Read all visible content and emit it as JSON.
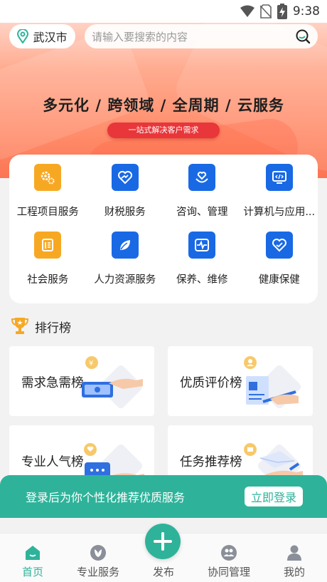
{
  "status_bar": {
    "time": "9:38",
    "icons": [
      "wifi-icon",
      "no-sim-icon",
      "battery-charging-icon"
    ]
  },
  "header": {
    "city": "武汉市",
    "search_placeholder": "请输入要搜索的内容"
  },
  "banner": {
    "title": "多元化 / 跨领域 / 全周期 / 云服务",
    "pill": "一站式解决客户需求"
  },
  "services": [
    {
      "label": "工程项目服务",
      "icon": "gear-cluster-icon",
      "color": "#f7a823"
    },
    {
      "label": "财税服务",
      "icon": "heart-card-icon",
      "color": "#1969e5"
    },
    {
      "label": "咨询、管理",
      "icon": "heart-hand-icon",
      "color": "#1969e5"
    },
    {
      "label": "计算机与应用...",
      "icon": "computer-code-icon",
      "color": "#1969e5"
    },
    {
      "label": "社会服务",
      "icon": "document-list-icon",
      "color": "#f7a823"
    },
    {
      "label": "人力资源服务",
      "icon": "leaf-icon",
      "color": "#1969e5"
    },
    {
      "label": "保养、维修",
      "icon": "pulse-monitor-icon",
      "color": "#1969e5"
    },
    {
      "label": "健康保健",
      "icon": "heart-shield-icon",
      "color": "#1969e5"
    }
  ],
  "ranking": {
    "title": "排行榜",
    "cards": [
      {
        "label": "需求急需榜",
        "icon": "cash-hand-illustration"
      },
      {
        "label": "优质评价榜",
        "icon": "contract-pen-illustration"
      },
      {
        "label": "专业人气榜",
        "icon": "chat-hand-illustration"
      },
      {
        "label": "任务推荐榜",
        "icon": "envelope-hand-illustration"
      }
    ]
  },
  "login_banner": {
    "text": "登录后为你个性化推荐优质服务",
    "button": "立即登录"
  },
  "bottom_nav": {
    "items": [
      {
        "label": "首页",
        "icon": "home-icon",
        "active": true
      },
      {
        "label": "专业服务",
        "icon": "leaf-badge-icon",
        "active": false
      },
      {
        "label": "发布",
        "icon": "plus-icon",
        "active": false
      },
      {
        "label": "协同管理",
        "icon": "team-icon",
        "active": false
      },
      {
        "label": "我的",
        "icon": "user-icon",
        "active": false
      }
    ]
  },
  "colors": {
    "primary": "#2eb39a",
    "orange": "#f7a823",
    "blue": "#1969e5",
    "hero": "#fb7553"
  }
}
